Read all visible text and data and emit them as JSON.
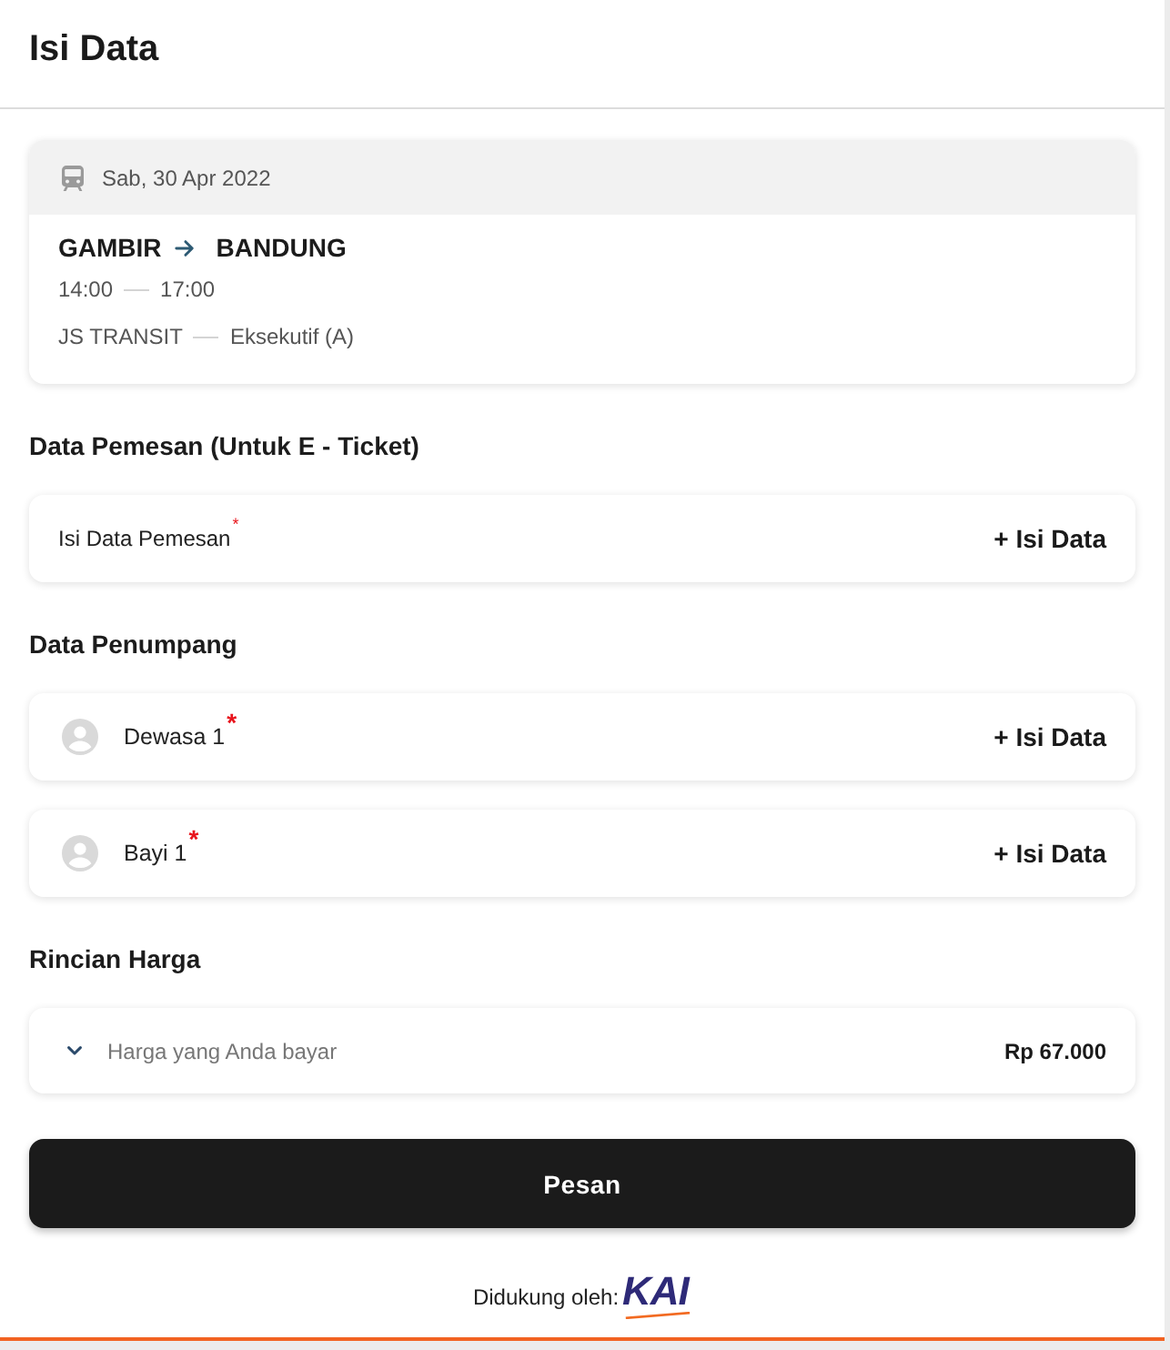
{
  "header": {
    "title": "Isi Data"
  },
  "trip": {
    "date": "Sab, 30 Apr 2022",
    "origin": "GAMBIR",
    "destination": "BANDUNG",
    "departure": "14:00",
    "arrival": "17:00",
    "train": "JS TRANSIT",
    "class": "Eksekutif (A)"
  },
  "sections": [
    {
      "title": "Data Pemesan (Untuk E - Ticket)",
      "rows": [
        {
          "kind": "orderer",
          "label": "Isi Data Pemesan",
          "required_mark": "*",
          "action": "+ Isi Data"
        }
      ]
    },
    {
      "title": "Data Penumpang",
      "rows": [
        {
          "kind": "passenger",
          "label": "Dewasa 1",
          "required_mark": "*",
          "action": "+ Isi Data"
        },
        {
          "kind": "passenger",
          "label": "Bayi 1",
          "required_mark": "*",
          "action": "+ Isi Data"
        }
      ]
    },
    {
      "title": "Rincian Harga",
      "rows": [
        {
          "kind": "price",
          "label": "Harga yang Anda bayar",
          "expanded": false,
          "amount": "Rp 67.000"
        }
      ]
    }
  ],
  "submit_button": "Pesan",
  "footer": {
    "supported_by": "Didukung oleh:",
    "logo": "KAI"
  }
}
